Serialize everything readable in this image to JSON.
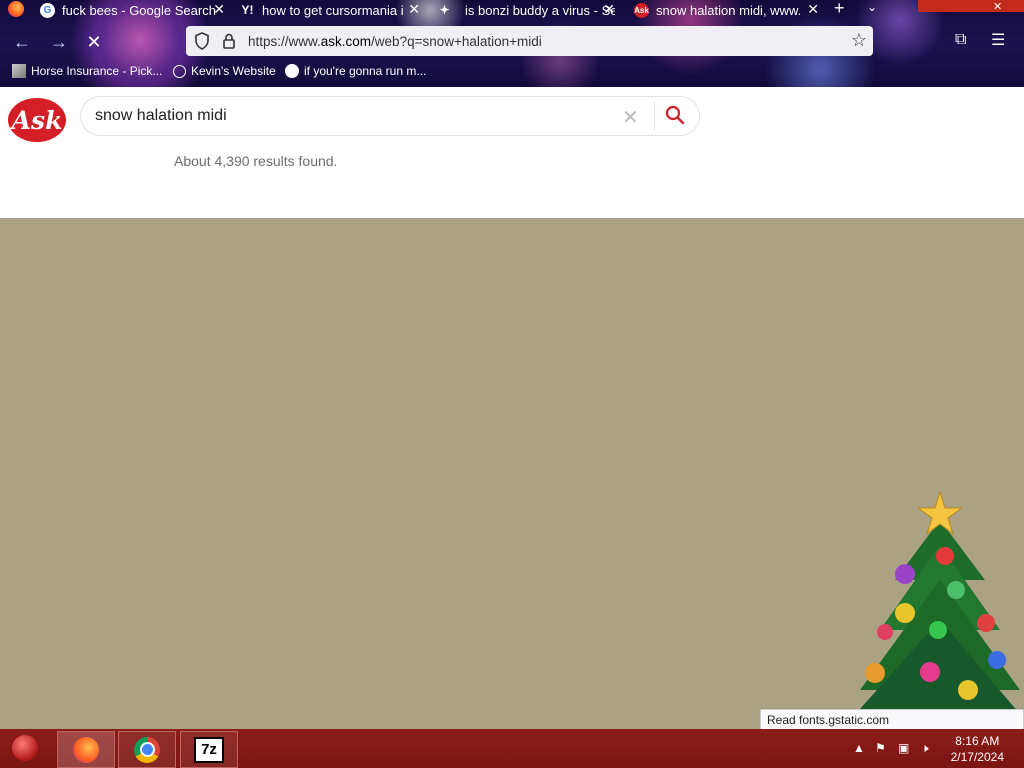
{
  "tabs": [
    {
      "label": "fuck bees - Google Search",
      "icon": "google-icon"
    },
    {
      "label": "how to get cursormania i",
      "icon": "yahoo-icon"
    },
    {
      "label": "is bonzi buddy a virus - Se",
      "icon": "sparkle-icon"
    },
    {
      "label": "snow halation midi, www.",
      "icon": "ask-icon"
    }
  ],
  "address_bar": {
    "url_prefix": "https://www.",
    "url_domain": "ask.com",
    "url_path": "/web?q=snow+halation+midi"
  },
  "bookmarks": [
    {
      "label": "Horse Insurance - Pick..."
    },
    {
      "label": "Kevin's Website"
    },
    {
      "label": "if you're gonna run m..."
    }
  ],
  "ask": {
    "logo_text": "Ask",
    "query": "snow halation midi",
    "results_count": "About 4,390 results found."
  },
  "status_bar": {
    "text": "Read fonts.gstatic.com"
  },
  "clock": {
    "time": "8:16 AM",
    "date": "2/17/2024"
  },
  "colors": {
    "ask_red": "#d51f26",
    "page_bg": "#aba283",
    "taskbar": "#8c1c18"
  }
}
